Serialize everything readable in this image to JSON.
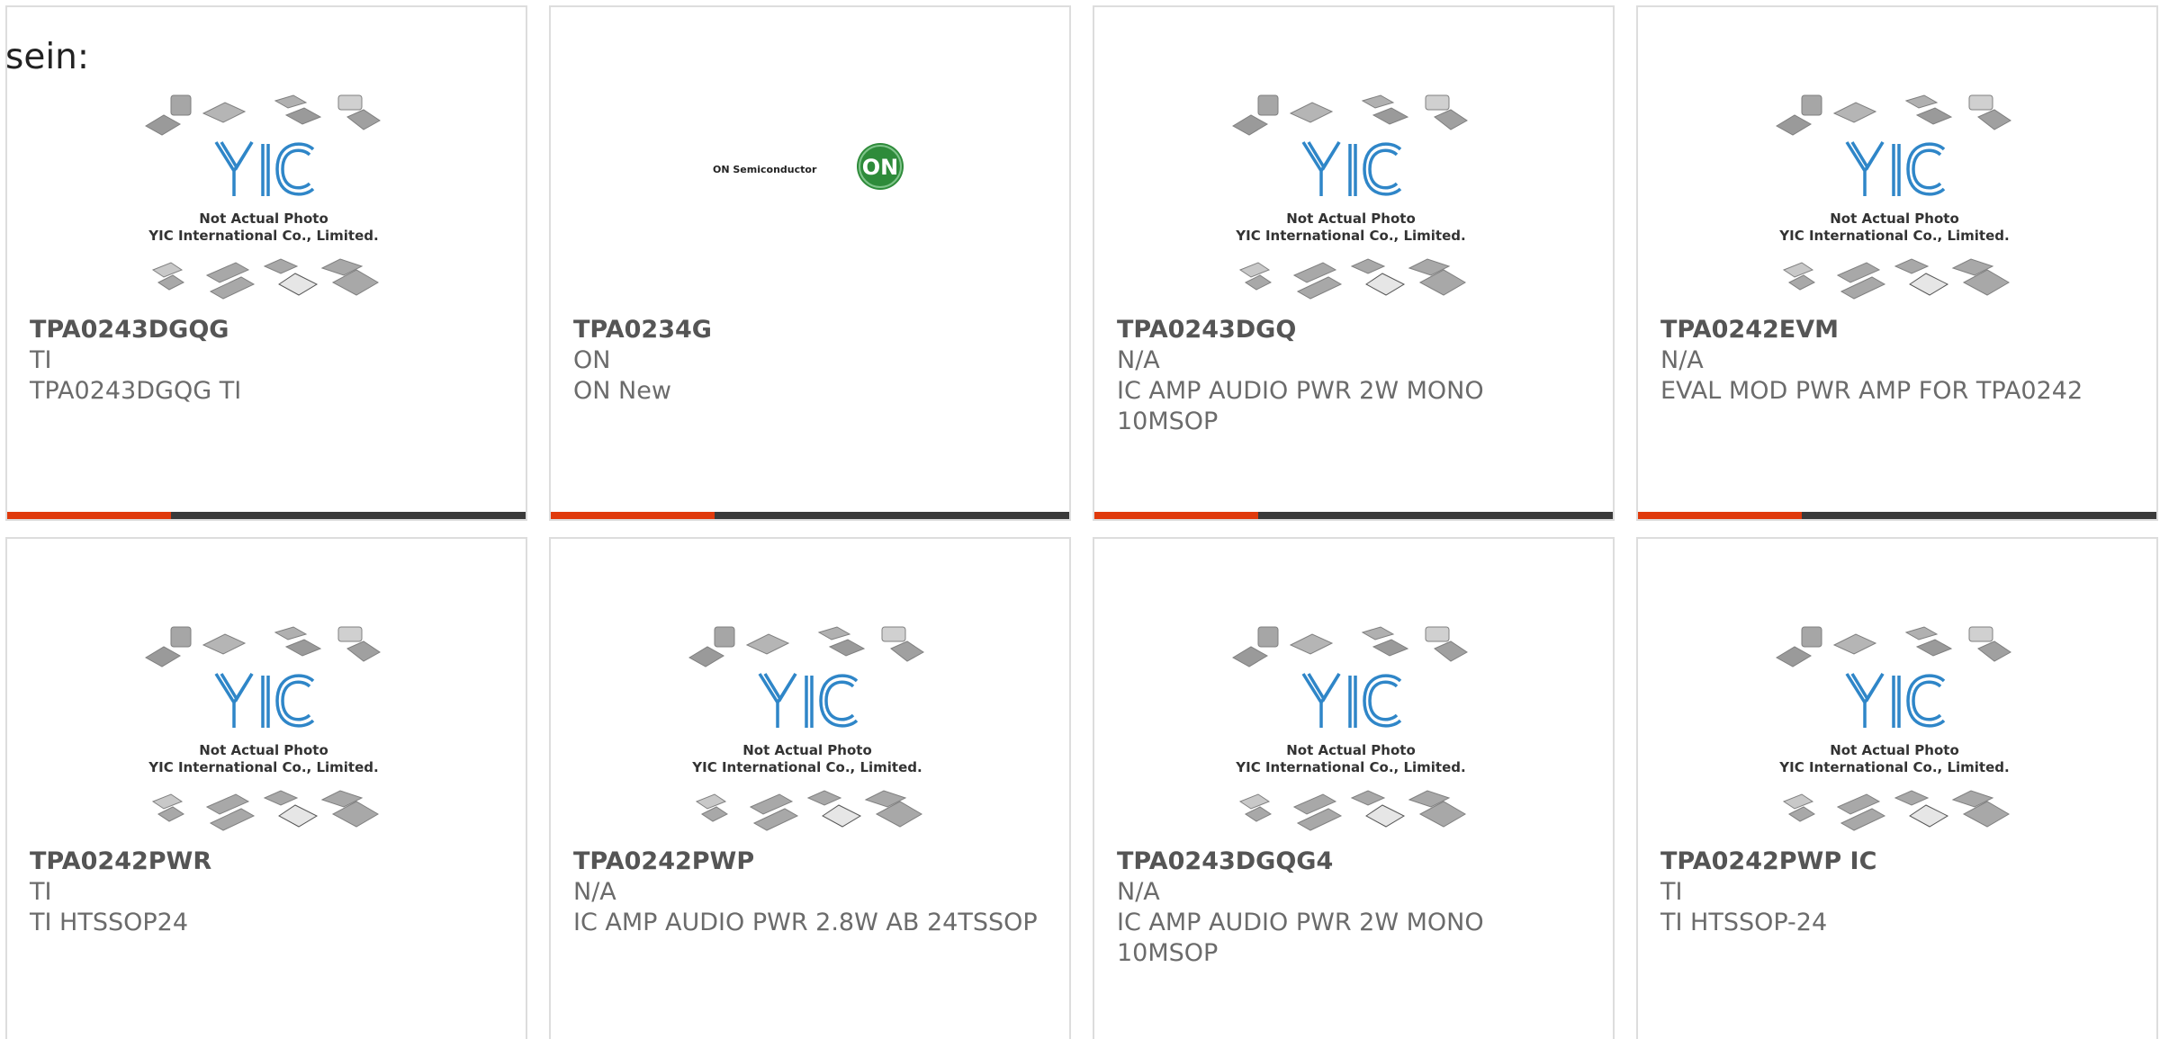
{
  "intro_text": "sein:",
  "placeholder": {
    "line1": "Not Actual Photo",
    "line2": "YIC International Co., Limited.",
    "logo_text": "YIC"
  },
  "on_logo": {
    "wordmark": "ON Semiconductor",
    "badge": "ON"
  },
  "colors": {
    "accent": "#e03a0c",
    "bar": "#3a3a3a",
    "yic_blue": "#2f86c8",
    "on_green": "#2e8b3a"
  },
  "products": [
    {
      "part": "TPA0243DGQG",
      "maker": "TI",
      "desc": "TPA0243DGQG TI",
      "image": "yic-placeholder-icon"
    },
    {
      "part": "TPA0234G",
      "maker": "ON",
      "desc": "ON New",
      "image": "on-semiconductor-logo"
    },
    {
      "part": "TPA0243DGQ",
      "maker": "N/A",
      "desc": "IC AMP AUDIO PWR 2W MONO 10MSOP",
      "image": "yic-placeholder-icon"
    },
    {
      "part": "TPA0242EVM",
      "maker": "N/A",
      "desc": "EVAL MOD PWR AMP FOR TPA0242",
      "image": "yic-placeholder-icon"
    },
    {
      "part": "TPA0242PWR",
      "maker": "TI",
      "desc": "TI HTSSOP24",
      "image": "yic-placeholder-icon"
    },
    {
      "part": "TPA0242PWP",
      "maker": "N/A",
      "desc": "IC AMP AUDIO PWR 2.8W AB 24TSSOP",
      "image": "yic-placeholder-icon"
    },
    {
      "part": "TPA0243DGQG4",
      "maker": "N/A",
      "desc": "IC AMP AUDIO PWR 2W MONO 10MSOP",
      "image": "yic-placeholder-icon"
    },
    {
      "part": "TPA0242PWP IC",
      "maker": "TI",
      "desc": "TI HTSSOP-24",
      "image": "yic-placeholder-icon"
    }
  ]
}
